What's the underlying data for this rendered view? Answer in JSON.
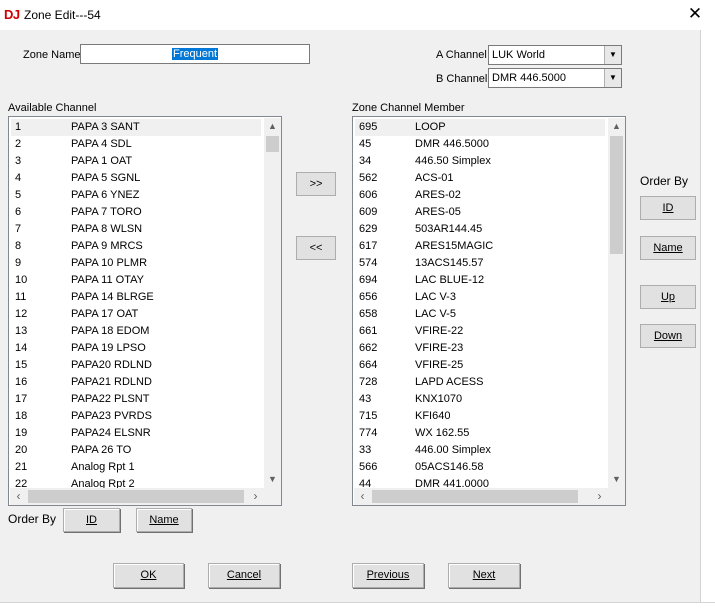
{
  "window": {
    "icon_text": "DJ",
    "title": "Zone Edit---54",
    "close_glyph": "✕"
  },
  "zone_name": {
    "label": "Zone Name",
    "value": "Frequent"
  },
  "a_channel": {
    "label": "A Channel",
    "value": "LUK World"
  },
  "b_channel": {
    "label": "B Channel",
    "value": "DMR 446.5000"
  },
  "available": {
    "label": "Available Channel",
    "rows": [
      {
        "num": "1",
        "name": "PAPA 3 SANT"
      },
      {
        "num": "2",
        "name": "PAPA 4 SDL"
      },
      {
        "num": "3",
        "name": "PAPA 1 OAT"
      },
      {
        "num": "4",
        "name": "PAPA 5 SGNL"
      },
      {
        "num": "5",
        "name": "PAPA 6 YNEZ"
      },
      {
        "num": "6",
        "name": "PAPA 7 TORO"
      },
      {
        "num": "7",
        "name": "PAPA 8 WLSN"
      },
      {
        "num": "8",
        "name": "PAPA 9 MRCS"
      },
      {
        "num": "9",
        "name": "PAPA 10 PLMR"
      },
      {
        "num": "10",
        "name": "PAPA 11 OTAY"
      },
      {
        "num": "11",
        "name": "PAPA 14 BLRGE"
      },
      {
        "num": "12",
        "name": "PAPA 17 OAT"
      },
      {
        "num": "13",
        "name": "PAPA 18 EDOM"
      },
      {
        "num": "14",
        "name": "PAPA 19 LPSO"
      },
      {
        "num": "15",
        "name": "PAPA20 RDLND"
      },
      {
        "num": "16",
        "name": "PAPA21 RDLND"
      },
      {
        "num": "17",
        "name": "PAPA22 PLSNT"
      },
      {
        "num": "18",
        "name": "PAPA23 PVRDS"
      },
      {
        "num": "19",
        "name": "PAPA24 ELSNR"
      },
      {
        "num": "20",
        "name": "PAPA 26 TO"
      },
      {
        "num": "21",
        "name": "Analog Rpt 1"
      },
      {
        "num": "22",
        "name": "Analog Rpt 2"
      }
    ]
  },
  "members": {
    "label": "Zone Channel Member",
    "rows": [
      {
        "num": "695",
        "name": "LOOP"
      },
      {
        "num": "45",
        "name": "DMR 446.5000"
      },
      {
        "num": "34",
        "name": "446.50 Simplex"
      },
      {
        "num": "562",
        "name": "ACS-01"
      },
      {
        "num": "606",
        "name": "ARES-02"
      },
      {
        "num": "609",
        "name": "ARES-05"
      },
      {
        "num": "629",
        "name": "503AR144.45"
      },
      {
        "num": "617",
        "name": "ARES15MAGIC"
      },
      {
        "num": "574",
        "name": "13ACS145.57"
      },
      {
        "num": "694",
        "name": "LAC BLUE-12"
      },
      {
        "num": "656",
        "name": "LAC V-3"
      },
      {
        "num": "658",
        "name": "LAC V-5"
      },
      {
        "num": "661",
        "name": "VFIRE-22"
      },
      {
        "num": "662",
        "name": "VFIRE-23"
      },
      {
        "num": "664",
        "name": "VFIRE-25"
      },
      {
        "num": "728",
        "name": "LAPD ACESS"
      },
      {
        "num": "43",
        "name": "KNX1070"
      },
      {
        "num": "715",
        "name": "KFI640"
      },
      {
        "num": "774",
        "name": "WX 162.55"
      },
      {
        "num": "33",
        "name": "446.00 Simplex"
      },
      {
        "num": "566",
        "name": "05ACS146.58"
      },
      {
        "num": "44",
        "name": "DMR 441.0000"
      }
    ]
  },
  "transfer": {
    "add_label": ">>",
    "remove_label": "<<"
  },
  "order_by_right": {
    "label": "Order By",
    "id_label": "ID",
    "name_label": "Name",
    "up_label": "Up",
    "down_label": "Down"
  },
  "order_by_bottom": {
    "label": "Order By",
    "id_label": "ID",
    "name_label": "Name"
  },
  "footer": {
    "ok_label": "OK",
    "cancel_label": "Cancel",
    "previous_label": "Previous",
    "next_label": "Next"
  },
  "icons": {
    "scroll_up": "▲",
    "scroll_down": "▼",
    "scroll_left": "‹",
    "scroll_right": "›",
    "dropdown": "▼"
  },
  "colors": {
    "selection": "#0078d7",
    "app_icon": "#d00000"
  }
}
